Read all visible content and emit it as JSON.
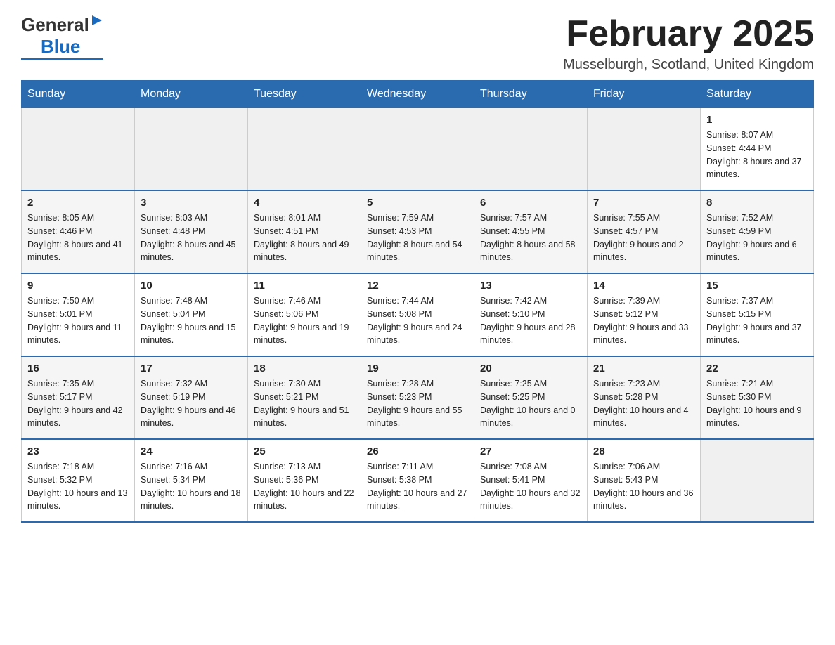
{
  "header": {
    "logo_general": "General",
    "logo_blue": "Blue",
    "month_title": "February 2025",
    "location": "Musselburgh, Scotland, United Kingdom"
  },
  "weekdays": [
    "Sunday",
    "Monday",
    "Tuesday",
    "Wednesday",
    "Thursday",
    "Friday",
    "Saturday"
  ],
  "weeks": [
    {
      "days": [
        {
          "number": "",
          "info": ""
        },
        {
          "number": "",
          "info": ""
        },
        {
          "number": "",
          "info": ""
        },
        {
          "number": "",
          "info": ""
        },
        {
          "number": "",
          "info": ""
        },
        {
          "number": "",
          "info": ""
        },
        {
          "number": "1",
          "info": "Sunrise: 8:07 AM\nSunset: 4:44 PM\nDaylight: 8 hours and 37 minutes."
        }
      ]
    },
    {
      "days": [
        {
          "number": "2",
          "info": "Sunrise: 8:05 AM\nSunset: 4:46 PM\nDaylight: 8 hours and 41 minutes."
        },
        {
          "number": "3",
          "info": "Sunrise: 8:03 AM\nSunset: 4:48 PM\nDaylight: 8 hours and 45 minutes."
        },
        {
          "number": "4",
          "info": "Sunrise: 8:01 AM\nSunset: 4:51 PM\nDaylight: 8 hours and 49 minutes."
        },
        {
          "number": "5",
          "info": "Sunrise: 7:59 AM\nSunset: 4:53 PM\nDaylight: 8 hours and 54 minutes."
        },
        {
          "number": "6",
          "info": "Sunrise: 7:57 AM\nSunset: 4:55 PM\nDaylight: 8 hours and 58 minutes."
        },
        {
          "number": "7",
          "info": "Sunrise: 7:55 AM\nSunset: 4:57 PM\nDaylight: 9 hours and 2 minutes."
        },
        {
          "number": "8",
          "info": "Sunrise: 7:52 AM\nSunset: 4:59 PM\nDaylight: 9 hours and 6 minutes."
        }
      ]
    },
    {
      "days": [
        {
          "number": "9",
          "info": "Sunrise: 7:50 AM\nSunset: 5:01 PM\nDaylight: 9 hours and 11 minutes."
        },
        {
          "number": "10",
          "info": "Sunrise: 7:48 AM\nSunset: 5:04 PM\nDaylight: 9 hours and 15 minutes."
        },
        {
          "number": "11",
          "info": "Sunrise: 7:46 AM\nSunset: 5:06 PM\nDaylight: 9 hours and 19 minutes."
        },
        {
          "number": "12",
          "info": "Sunrise: 7:44 AM\nSunset: 5:08 PM\nDaylight: 9 hours and 24 minutes."
        },
        {
          "number": "13",
          "info": "Sunrise: 7:42 AM\nSunset: 5:10 PM\nDaylight: 9 hours and 28 minutes."
        },
        {
          "number": "14",
          "info": "Sunrise: 7:39 AM\nSunset: 5:12 PM\nDaylight: 9 hours and 33 minutes."
        },
        {
          "number": "15",
          "info": "Sunrise: 7:37 AM\nSunset: 5:15 PM\nDaylight: 9 hours and 37 minutes."
        }
      ]
    },
    {
      "days": [
        {
          "number": "16",
          "info": "Sunrise: 7:35 AM\nSunset: 5:17 PM\nDaylight: 9 hours and 42 minutes."
        },
        {
          "number": "17",
          "info": "Sunrise: 7:32 AM\nSunset: 5:19 PM\nDaylight: 9 hours and 46 minutes."
        },
        {
          "number": "18",
          "info": "Sunrise: 7:30 AM\nSunset: 5:21 PM\nDaylight: 9 hours and 51 minutes."
        },
        {
          "number": "19",
          "info": "Sunrise: 7:28 AM\nSunset: 5:23 PM\nDaylight: 9 hours and 55 minutes."
        },
        {
          "number": "20",
          "info": "Sunrise: 7:25 AM\nSunset: 5:25 PM\nDaylight: 10 hours and 0 minutes."
        },
        {
          "number": "21",
          "info": "Sunrise: 7:23 AM\nSunset: 5:28 PM\nDaylight: 10 hours and 4 minutes."
        },
        {
          "number": "22",
          "info": "Sunrise: 7:21 AM\nSunset: 5:30 PM\nDaylight: 10 hours and 9 minutes."
        }
      ]
    },
    {
      "days": [
        {
          "number": "23",
          "info": "Sunrise: 7:18 AM\nSunset: 5:32 PM\nDaylight: 10 hours and 13 minutes."
        },
        {
          "number": "24",
          "info": "Sunrise: 7:16 AM\nSunset: 5:34 PM\nDaylight: 10 hours and 18 minutes."
        },
        {
          "number": "25",
          "info": "Sunrise: 7:13 AM\nSunset: 5:36 PM\nDaylight: 10 hours and 22 minutes."
        },
        {
          "number": "26",
          "info": "Sunrise: 7:11 AM\nSunset: 5:38 PM\nDaylight: 10 hours and 27 minutes."
        },
        {
          "number": "27",
          "info": "Sunrise: 7:08 AM\nSunset: 5:41 PM\nDaylight: 10 hours and 32 minutes."
        },
        {
          "number": "28",
          "info": "Sunrise: 7:06 AM\nSunset: 5:43 PM\nDaylight: 10 hours and 36 minutes."
        },
        {
          "number": "",
          "info": ""
        }
      ]
    }
  ]
}
